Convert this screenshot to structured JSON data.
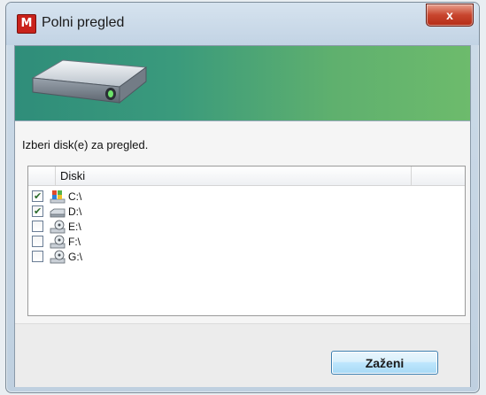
{
  "window": {
    "title": "Polni pregled",
    "app_icon_letter": "M",
    "close_glyph": "x"
  },
  "content": {
    "instruction": "Izberi disk(e) za pregled.",
    "listview": {
      "header": "Diski",
      "drives": [
        {
          "label": "C:\\",
          "checked": true,
          "icon": "system-drive-icon"
        },
        {
          "label": "D:\\",
          "checked": true,
          "icon": "hard-drive-icon"
        },
        {
          "label": "E:\\",
          "checked": false,
          "icon": "optical-drive-icon"
        },
        {
          "label": "F:\\",
          "checked": false,
          "icon": "optical-drive-icon"
        },
        {
          "label": "G:\\",
          "checked": false,
          "icon": "optical-drive-icon"
        }
      ]
    }
  },
  "footer": {
    "run_label": "Zaženi"
  },
  "colors": {
    "banner_start": "#2f8d7a",
    "banner_end": "#6dbb6c",
    "close_red": "#c8452e",
    "check_green": "#2a6a2a"
  }
}
